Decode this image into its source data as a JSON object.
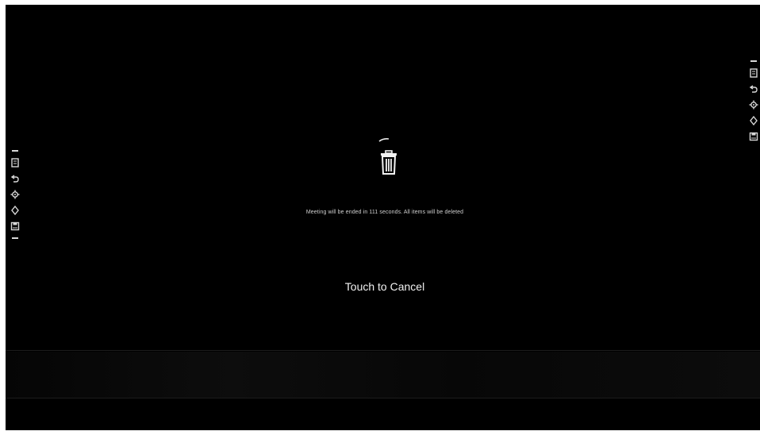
{
  "dialog": {
    "icon": "trash-icon",
    "countdown_message": "Meeting will be ended in 111 seconds. All items will be deleted",
    "cancel_label": "Touch to Cancel"
  },
  "left_toolbar": {
    "icons": [
      "edit-icon",
      "undo-icon",
      "settings-icon",
      "move-icon",
      "save-icon"
    ]
  },
  "right_toolbar": {
    "icons": [
      "edit-icon",
      "undo-icon",
      "settings-icon",
      "move-icon",
      "save-icon"
    ]
  },
  "colors": {
    "background": "#000000",
    "foreground": "#f2f2f2",
    "frame": "#ffffff"
  }
}
